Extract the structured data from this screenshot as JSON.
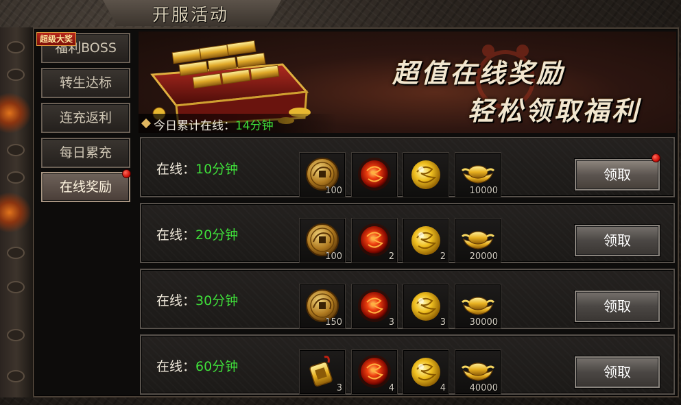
{
  "window": {
    "title": "开服活动"
  },
  "sidebar": {
    "badge": "超级大奖",
    "tabs": [
      {
        "label": "福利BOSS",
        "active": false
      },
      {
        "label": "转生达标",
        "active": false
      },
      {
        "label": "连充返利",
        "active": false
      },
      {
        "label": "每日累充",
        "active": false
      },
      {
        "label": "在线奖励",
        "active": true
      }
    ]
  },
  "banner": {
    "line1": "超值在线奖励",
    "line2": "轻松领取福利",
    "today_label": "今日累计在线：",
    "today_value": "14分钟"
  },
  "rows": [
    {
      "label": "在线：",
      "time": "10分钟",
      "items": [
        {
          "icon": "copper-coin-icon",
          "qty": "100"
        },
        {
          "icon": "red-dragon-orb-icon",
          "qty": ""
        },
        {
          "icon": "gold-dragon-orb-icon",
          "qty": ""
        },
        {
          "icon": "gold-ingot-icon",
          "qty": "10000"
        }
      ],
      "button": "领取",
      "has_dot": true
    },
    {
      "label": "在线：",
      "time": "20分钟",
      "items": [
        {
          "icon": "copper-coin-icon",
          "qty": "100"
        },
        {
          "icon": "red-dragon-orb-icon",
          "qty": "2"
        },
        {
          "icon": "gold-dragon-orb-icon",
          "qty": "2"
        },
        {
          "icon": "gold-ingot-icon",
          "qty": "20000"
        }
      ],
      "button": "领取",
      "has_dot": false
    },
    {
      "label": "在线：",
      "time": "30分钟",
      "items": [
        {
          "icon": "copper-coin-icon",
          "qty": "150"
        },
        {
          "icon": "red-dragon-orb-icon",
          "qty": "3"
        },
        {
          "icon": "gold-dragon-orb-icon",
          "qty": "3"
        },
        {
          "icon": "gold-ingot-icon",
          "qty": "30000"
        }
      ],
      "button": "领取",
      "has_dot": false
    },
    {
      "label": "在线：",
      "time": "60分钟",
      "items": [
        {
          "icon": "gold-token-icon",
          "qty": "3"
        },
        {
          "icon": "red-dragon-orb-icon",
          "qty": "4"
        },
        {
          "icon": "gold-dragon-orb-icon",
          "qty": "4"
        },
        {
          "icon": "gold-ingot-icon",
          "qty": "40000"
        }
      ],
      "button": "领取",
      "has_dot": false
    }
  ],
  "colors": {
    "highlight_green": "#3fe03a",
    "notify_red": "#d0120a",
    "gold": "#e0b660"
  }
}
